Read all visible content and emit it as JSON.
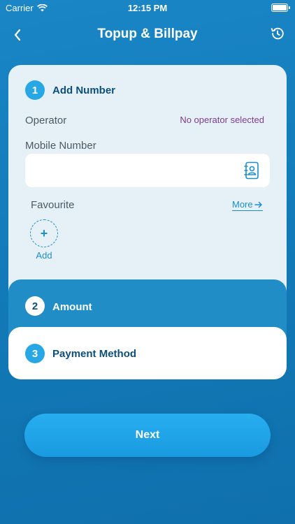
{
  "status_bar": {
    "carrier": "Carrier",
    "time": "12:15 PM"
  },
  "nav": {
    "title": "Topup & Billpay",
    "back_icon": "chevron-left-icon",
    "history_icon": "history-icon"
  },
  "step1": {
    "number": "1",
    "title": "Add Number",
    "operator_label": "Operator",
    "operator_value": "No operator selected",
    "mobile_label": "Mobile Number",
    "mobile_value": "",
    "favourite_label": "Favourite",
    "more_label": "More",
    "add_label": "Add",
    "add_symbol": "+"
  },
  "step2": {
    "number": "2",
    "title": "Amount"
  },
  "step3": {
    "number": "3",
    "title": "Payment Method"
  },
  "actions": {
    "next_label": "Next"
  },
  "colors": {
    "primary": "#1a86c6",
    "accent": "#27a7e4",
    "card_light": "#e6f1f7",
    "operator_text": "#7a3c8c",
    "title_text": "#0b4f7d"
  }
}
